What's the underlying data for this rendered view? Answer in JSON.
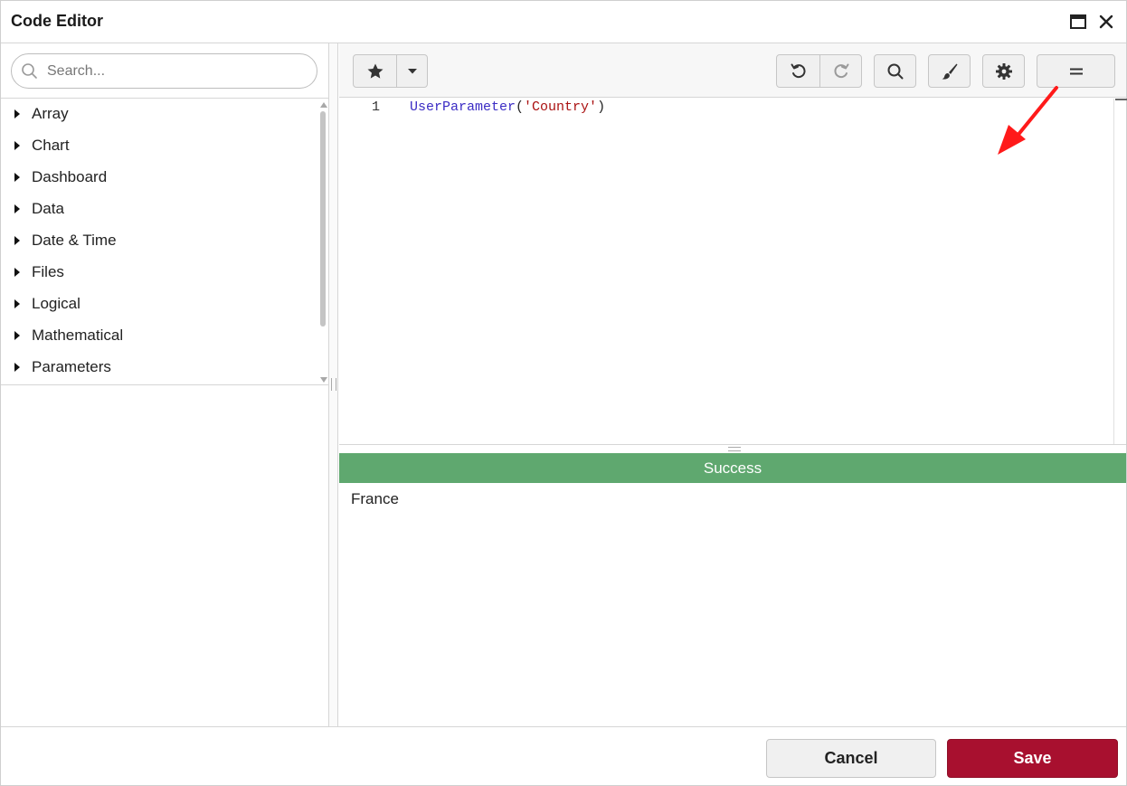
{
  "window": {
    "title": "Code Editor"
  },
  "sidebar": {
    "search_placeholder": "Search...",
    "categories": [
      {
        "label": "Array"
      },
      {
        "label": "Chart"
      },
      {
        "label": "Dashboard"
      },
      {
        "label": "Data"
      },
      {
        "label": "Date & Time"
      },
      {
        "label": "Files"
      },
      {
        "label": "Logical"
      },
      {
        "label": "Mathematical"
      },
      {
        "label": "Parameters"
      }
    ]
  },
  "toolbar": {
    "buttons": [
      "star-icon",
      "chevron-down-icon",
      "undo-icon",
      "redo-icon",
      "search-icon",
      "brush-icon",
      "gear-icon",
      "equals-icon"
    ]
  },
  "editor": {
    "line_number": "1",
    "code": {
      "function": "UserParameter",
      "open": "(",
      "string": "'Country'",
      "close": ")"
    }
  },
  "output": {
    "status": "Success",
    "status_color": "#5fa86f",
    "result": "France"
  },
  "footer": {
    "cancel_label": "Cancel",
    "save_label": "Save",
    "save_color": "#a8102f"
  },
  "annotation": {
    "color": "#ff0000",
    "type": "red-arrow-pointing-down-left"
  }
}
